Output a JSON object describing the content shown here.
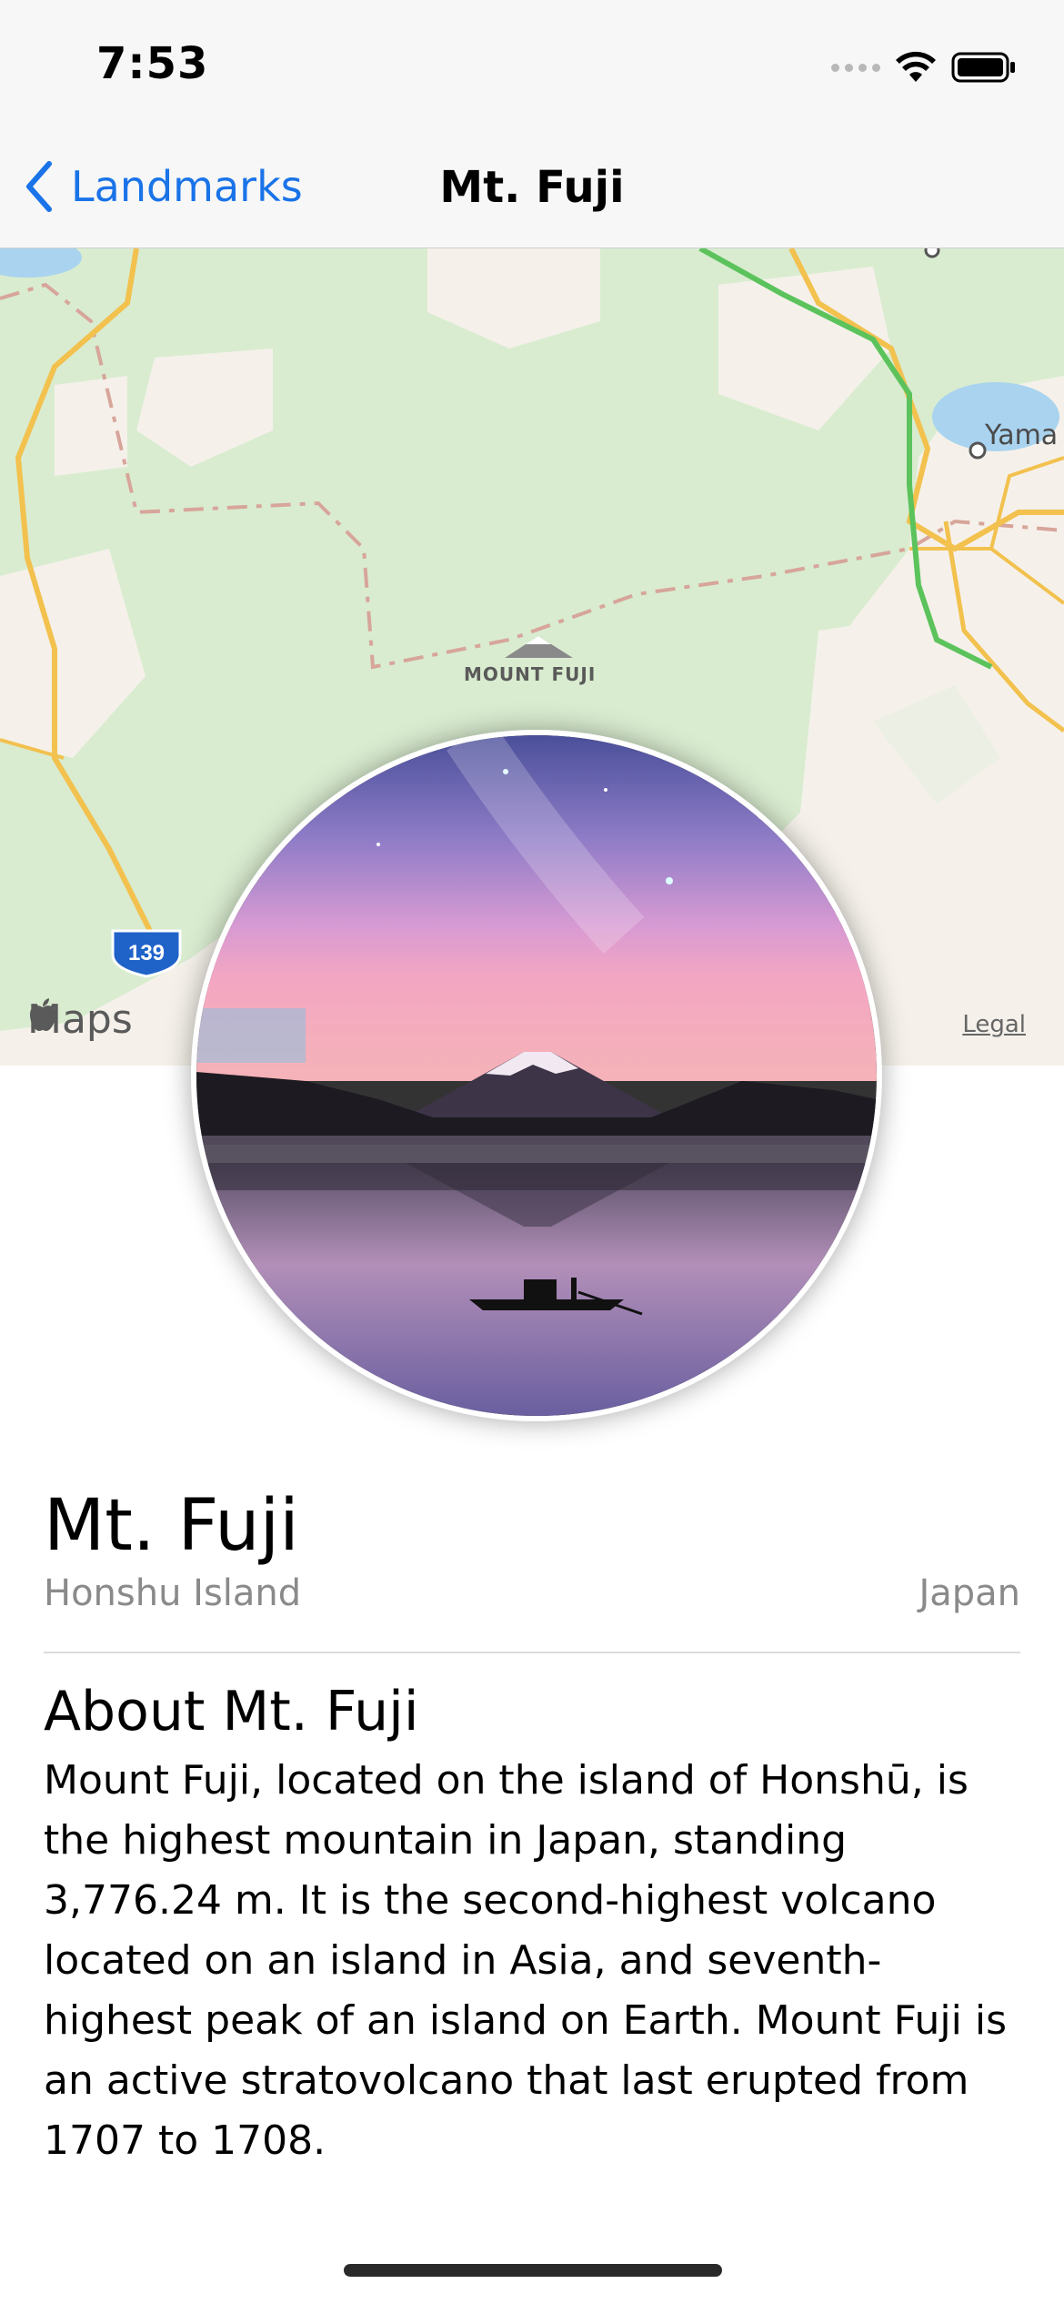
{
  "status_bar": {
    "time": "7:53"
  },
  "nav": {
    "back_label": "Landmarks",
    "title": "Mt. Fuji"
  },
  "map": {
    "landmark_label": "MOUNT FUJI",
    "city_label": "Yama",
    "route_number": "139",
    "attribution": "Maps",
    "legal_link": "Legal"
  },
  "landmark": {
    "name": "Mt. Fuji",
    "park": "Honshu Island",
    "state": "Japan",
    "about_title": "About Mt. Fuji",
    "description": "Mount Fuji, located on the island of Honshū, is the highest mountain in Japan, standing 3,776.24 m. It is the second-highest volcano located on an island in Asia, and seventh-highest peak of an island on Earth. Mount Fuji is an active stratovolcano that last erupted from 1707 to 1708."
  },
  "colors": {
    "accent": "#1a73e8",
    "secondary_text": "#8a8a8a",
    "map_land": "#f5f1ea",
    "map_park": "#d9ecd0",
    "map_road": "#f2c14e",
    "map_highway": "#5cc35c",
    "map_water": "#a9d3ef"
  },
  "icons": {
    "back": "chevron-left-icon",
    "signal": "cellular-signal-icon",
    "wifi": "wifi-icon",
    "battery": "battery-icon",
    "apple": "apple-logo-icon",
    "mountain": "mountain-icon"
  }
}
